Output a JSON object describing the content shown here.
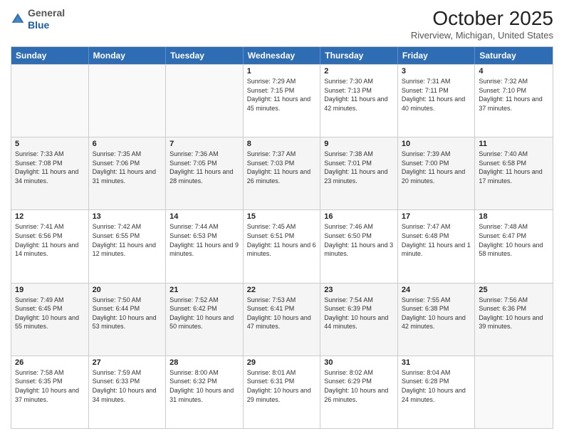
{
  "logo": {
    "general": "General",
    "blue": "Blue"
  },
  "header": {
    "month": "October 2025",
    "location": "Riverview, Michigan, United States"
  },
  "days": [
    "Sunday",
    "Monday",
    "Tuesday",
    "Wednesday",
    "Thursday",
    "Friday",
    "Saturday"
  ],
  "weeks": [
    [
      {
        "day": "",
        "sunrise": "",
        "sunset": "",
        "daylight": "",
        "empty": true
      },
      {
        "day": "",
        "sunrise": "",
        "sunset": "",
        "daylight": "",
        "empty": true
      },
      {
        "day": "",
        "sunrise": "",
        "sunset": "",
        "daylight": "",
        "empty": true
      },
      {
        "day": "1",
        "sunrise": "Sunrise: 7:29 AM",
        "sunset": "Sunset: 7:15 PM",
        "daylight": "Daylight: 11 hours and 45 minutes."
      },
      {
        "day": "2",
        "sunrise": "Sunrise: 7:30 AM",
        "sunset": "Sunset: 7:13 PM",
        "daylight": "Daylight: 11 hours and 42 minutes."
      },
      {
        "day": "3",
        "sunrise": "Sunrise: 7:31 AM",
        "sunset": "Sunset: 7:11 PM",
        "daylight": "Daylight: 11 hours and 40 minutes."
      },
      {
        "day": "4",
        "sunrise": "Sunrise: 7:32 AM",
        "sunset": "Sunset: 7:10 PM",
        "daylight": "Daylight: 11 hours and 37 minutes."
      }
    ],
    [
      {
        "day": "5",
        "sunrise": "Sunrise: 7:33 AM",
        "sunset": "Sunset: 7:08 PM",
        "daylight": "Daylight: 11 hours and 34 minutes."
      },
      {
        "day": "6",
        "sunrise": "Sunrise: 7:35 AM",
        "sunset": "Sunset: 7:06 PM",
        "daylight": "Daylight: 11 hours and 31 minutes."
      },
      {
        "day": "7",
        "sunrise": "Sunrise: 7:36 AM",
        "sunset": "Sunset: 7:05 PM",
        "daylight": "Daylight: 11 hours and 28 minutes."
      },
      {
        "day": "8",
        "sunrise": "Sunrise: 7:37 AM",
        "sunset": "Sunset: 7:03 PM",
        "daylight": "Daylight: 11 hours and 26 minutes."
      },
      {
        "day": "9",
        "sunrise": "Sunrise: 7:38 AM",
        "sunset": "Sunset: 7:01 PM",
        "daylight": "Daylight: 11 hours and 23 minutes."
      },
      {
        "day": "10",
        "sunrise": "Sunrise: 7:39 AM",
        "sunset": "Sunset: 7:00 PM",
        "daylight": "Daylight: 11 hours and 20 minutes."
      },
      {
        "day": "11",
        "sunrise": "Sunrise: 7:40 AM",
        "sunset": "Sunset: 6:58 PM",
        "daylight": "Daylight: 11 hours and 17 minutes."
      }
    ],
    [
      {
        "day": "12",
        "sunrise": "Sunrise: 7:41 AM",
        "sunset": "Sunset: 6:56 PM",
        "daylight": "Daylight: 11 hours and 14 minutes."
      },
      {
        "day": "13",
        "sunrise": "Sunrise: 7:42 AM",
        "sunset": "Sunset: 6:55 PM",
        "daylight": "Daylight: 11 hours and 12 minutes."
      },
      {
        "day": "14",
        "sunrise": "Sunrise: 7:44 AM",
        "sunset": "Sunset: 6:53 PM",
        "daylight": "Daylight: 11 hours and 9 minutes."
      },
      {
        "day": "15",
        "sunrise": "Sunrise: 7:45 AM",
        "sunset": "Sunset: 6:51 PM",
        "daylight": "Daylight: 11 hours and 6 minutes."
      },
      {
        "day": "16",
        "sunrise": "Sunrise: 7:46 AM",
        "sunset": "Sunset: 6:50 PM",
        "daylight": "Daylight: 11 hours and 3 minutes."
      },
      {
        "day": "17",
        "sunrise": "Sunrise: 7:47 AM",
        "sunset": "Sunset: 6:48 PM",
        "daylight": "Daylight: 11 hours and 1 minute."
      },
      {
        "day": "18",
        "sunrise": "Sunrise: 7:48 AM",
        "sunset": "Sunset: 6:47 PM",
        "daylight": "Daylight: 10 hours and 58 minutes."
      }
    ],
    [
      {
        "day": "19",
        "sunrise": "Sunrise: 7:49 AM",
        "sunset": "Sunset: 6:45 PM",
        "daylight": "Daylight: 10 hours and 55 minutes."
      },
      {
        "day": "20",
        "sunrise": "Sunrise: 7:50 AM",
        "sunset": "Sunset: 6:44 PM",
        "daylight": "Daylight: 10 hours and 53 minutes."
      },
      {
        "day": "21",
        "sunrise": "Sunrise: 7:52 AM",
        "sunset": "Sunset: 6:42 PM",
        "daylight": "Daylight: 10 hours and 50 minutes."
      },
      {
        "day": "22",
        "sunrise": "Sunrise: 7:53 AM",
        "sunset": "Sunset: 6:41 PM",
        "daylight": "Daylight: 10 hours and 47 minutes."
      },
      {
        "day": "23",
        "sunrise": "Sunrise: 7:54 AM",
        "sunset": "Sunset: 6:39 PM",
        "daylight": "Daylight: 10 hours and 44 minutes."
      },
      {
        "day": "24",
        "sunrise": "Sunrise: 7:55 AM",
        "sunset": "Sunset: 6:38 PM",
        "daylight": "Daylight: 10 hours and 42 minutes."
      },
      {
        "day": "25",
        "sunrise": "Sunrise: 7:56 AM",
        "sunset": "Sunset: 6:36 PM",
        "daylight": "Daylight: 10 hours and 39 minutes."
      }
    ],
    [
      {
        "day": "26",
        "sunrise": "Sunrise: 7:58 AM",
        "sunset": "Sunset: 6:35 PM",
        "daylight": "Daylight: 10 hours and 37 minutes."
      },
      {
        "day": "27",
        "sunrise": "Sunrise: 7:59 AM",
        "sunset": "Sunset: 6:33 PM",
        "daylight": "Daylight: 10 hours and 34 minutes."
      },
      {
        "day": "28",
        "sunrise": "Sunrise: 8:00 AM",
        "sunset": "Sunset: 6:32 PM",
        "daylight": "Daylight: 10 hours and 31 minutes."
      },
      {
        "day": "29",
        "sunrise": "Sunrise: 8:01 AM",
        "sunset": "Sunset: 6:31 PM",
        "daylight": "Daylight: 10 hours and 29 minutes."
      },
      {
        "day": "30",
        "sunrise": "Sunrise: 8:02 AM",
        "sunset": "Sunset: 6:29 PM",
        "daylight": "Daylight: 10 hours and 26 minutes."
      },
      {
        "day": "31",
        "sunrise": "Sunrise: 8:04 AM",
        "sunset": "Sunset: 6:28 PM",
        "daylight": "Daylight: 10 hours and 24 minutes."
      },
      {
        "day": "",
        "sunrise": "",
        "sunset": "",
        "daylight": "",
        "empty": true
      }
    ]
  ]
}
